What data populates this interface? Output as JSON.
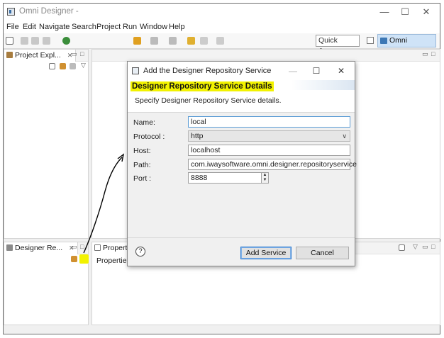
{
  "app": {
    "title": "Omni Designer -",
    "window_buttons": {
      "minimize": "—",
      "maximize": "☐",
      "close": "✕"
    }
  },
  "menubar": [
    "File",
    "Edit",
    "Navigate",
    "Search",
    "Project",
    "Run",
    "Window",
    "Help"
  ],
  "toolbar": {
    "quick_access": "Quick Access",
    "perspective": "Omni Designer"
  },
  "panels": {
    "project_explorer": {
      "tab": "Project Expl..."
    },
    "designer_repository": {
      "tab": "Designer Re..."
    },
    "properties": {
      "tab": "Properti",
      "content": "Properties"
    }
  },
  "dialog": {
    "title": "Add the Designer Repository Service",
    "heading": "Designer Repository Service Details",
    "subtitle": "Specify Designer Repository Service details.",
    "fields": {
      "name": {
        "label": "Name:",
        "value": "local"
      },
      "protocol": {
        "label": "Protocol :",
        "value": "http"
      },
      "host": {
        "label": "Host:",
        "value": "localhost"
      },
      "path": {
        "label": "Path:",
        "value": "com.iwaysoftware.omni.designer.repositoryservice"
      },
      "port": {
        "label": "Port :",
        "value": "8888"
      }
    },
    "buttons": {
      "add": "Add Service",
      "cancel": "Cancel",
      "help": "?"
    }
  },
  "colors": {
    "highlight": "#f2f200",
    "perspective_active": "#cfe3f7",
    "annotation_arrow": "#000000"
  }
}
